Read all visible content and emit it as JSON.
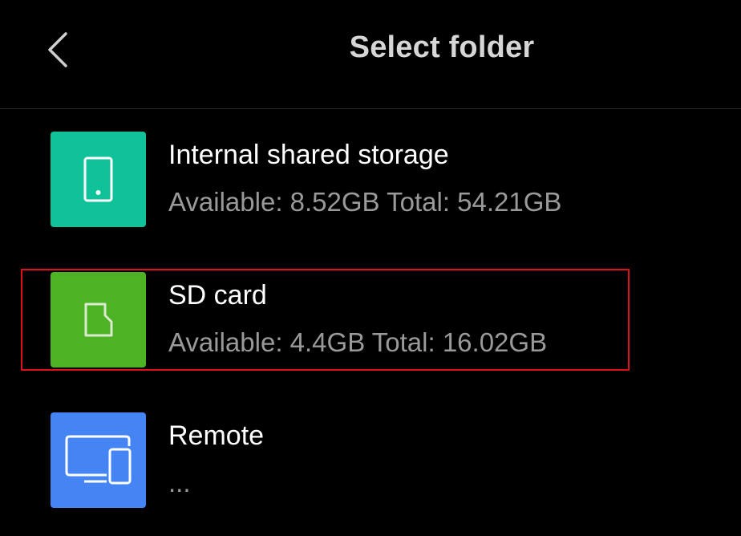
{
  "header": {
    "title": "Select folder",
    "back_icon": "chevron-left-icon"
  },
  "storage_items": [
    {
      "name": "Internal shared storage",
      "info": "Available: 8.52GB Total: 54.21GB",
      "icon": "phone-icon",
      "color": "#0fc29a"
    },
    {
      "name": "SD card",
      "info": "Available: 4.4GB Total: 16.02GB",
      "icon": "sd-card-icon",
      "color": "#4db325"
    },
    {
      "name": "Remote",
      "info": "...",
      "icon": "devices-icon",
      "color": "#4484f3"
    }
  ],
  "highlight_color": "#e0101a"
}
